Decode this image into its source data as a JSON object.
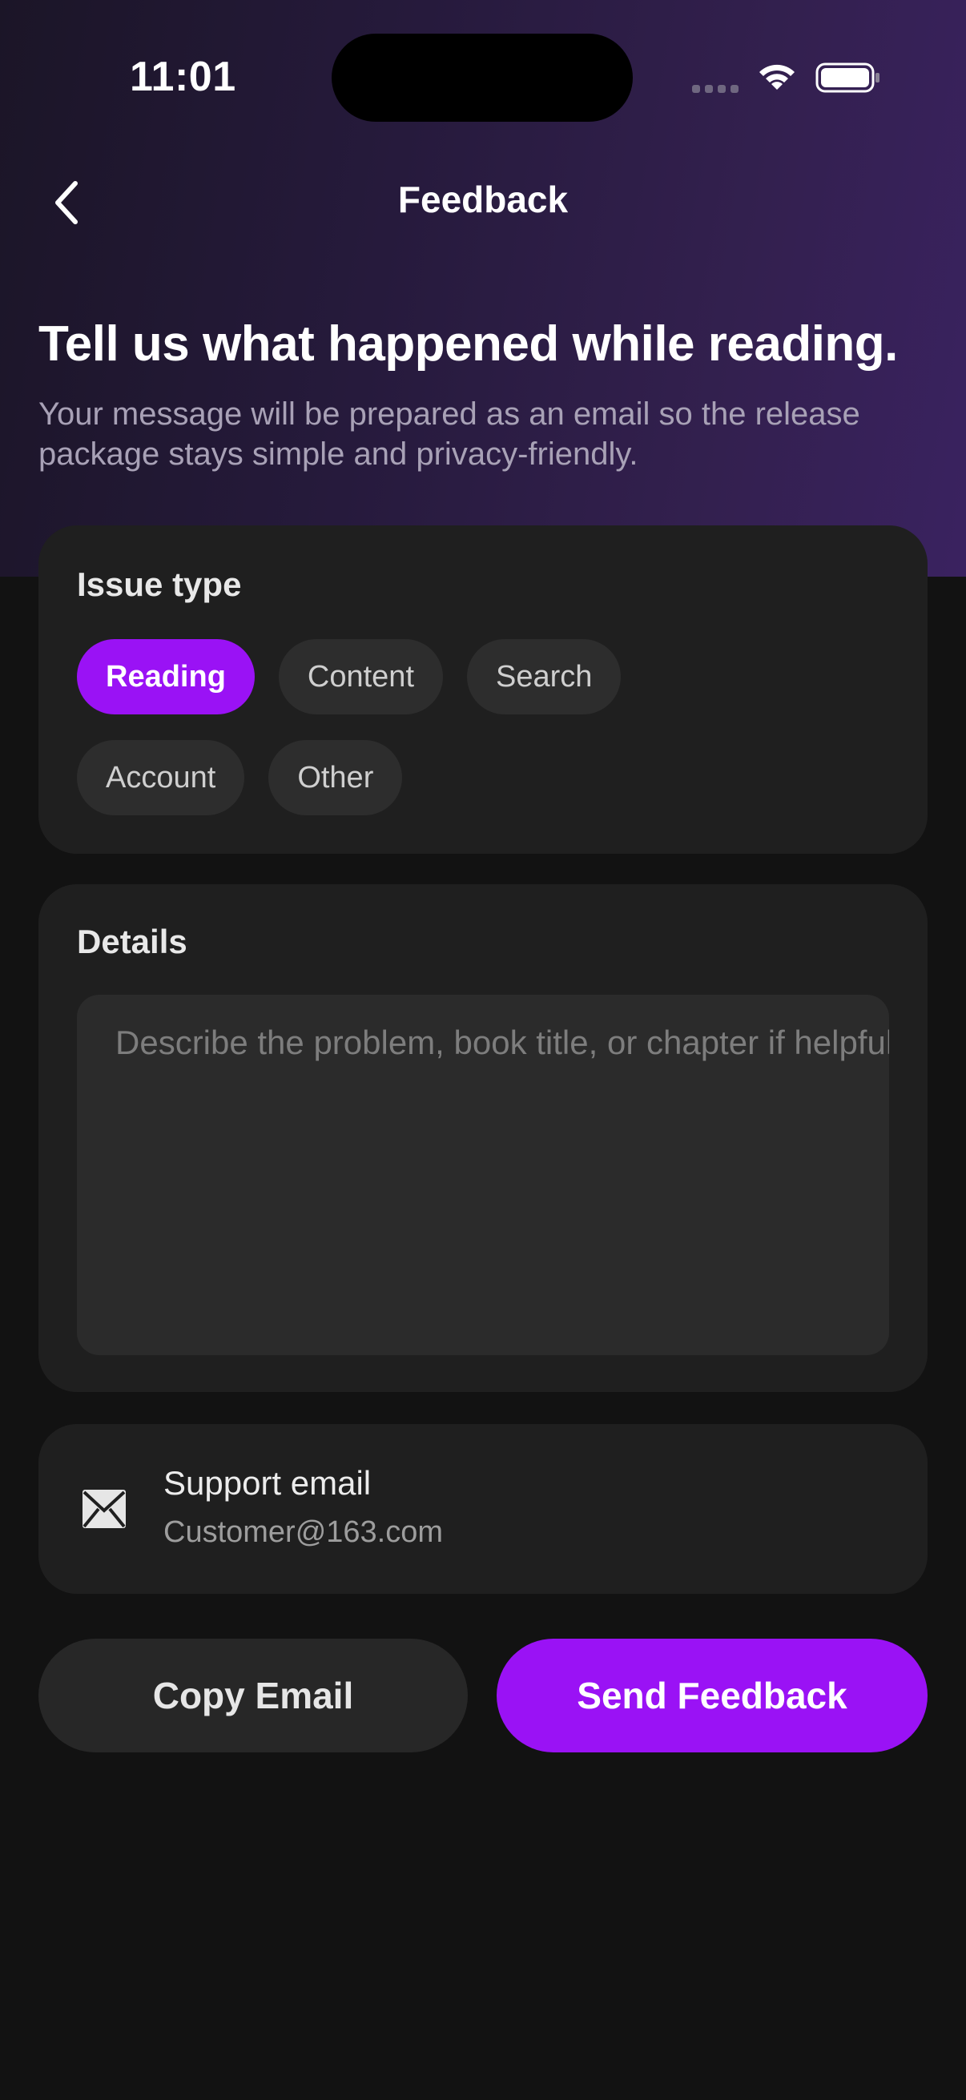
{
  "status_bar": {
    "time": "11:01"
  },
  "nav": {
    "title": "Feedback",
    "back_icon": "chevron-left-icon"
  },
  "hero": {
    "headline": "Tell us what happened while reading.",
    "subtitle": "Your message will be prepared as an email so the release package stays simple and privacy-friendly."
  },
  "issue_type": {
    "label": "Issue type",
    "options": [
      "Reading",
      "Content",
      "Search",
      "Account",
      "Other"
    ],
    "selected": "Reading"
  },
  "details": {
    "label": "Details",
    "placeholder": "Describe the problem, book title, or chapter if helpful.",
    "value": ""
  },
  "support": {
    "icon": "envelope-icon",
    "title": "Support email",
    "email": "Customer@163.com"
  },
  "actions": {
    "copy_label": "Copy Email",
    "send_label": "Send Feedback"
  },
  "colors": {
    "accent": "#9A12F5",
    "background": "#121212",
    "card": "#1F1F1F",
    "hero_gradient_start": "#1B1527",
    "hero_gradient_end": "#3A2260"
  }
}
